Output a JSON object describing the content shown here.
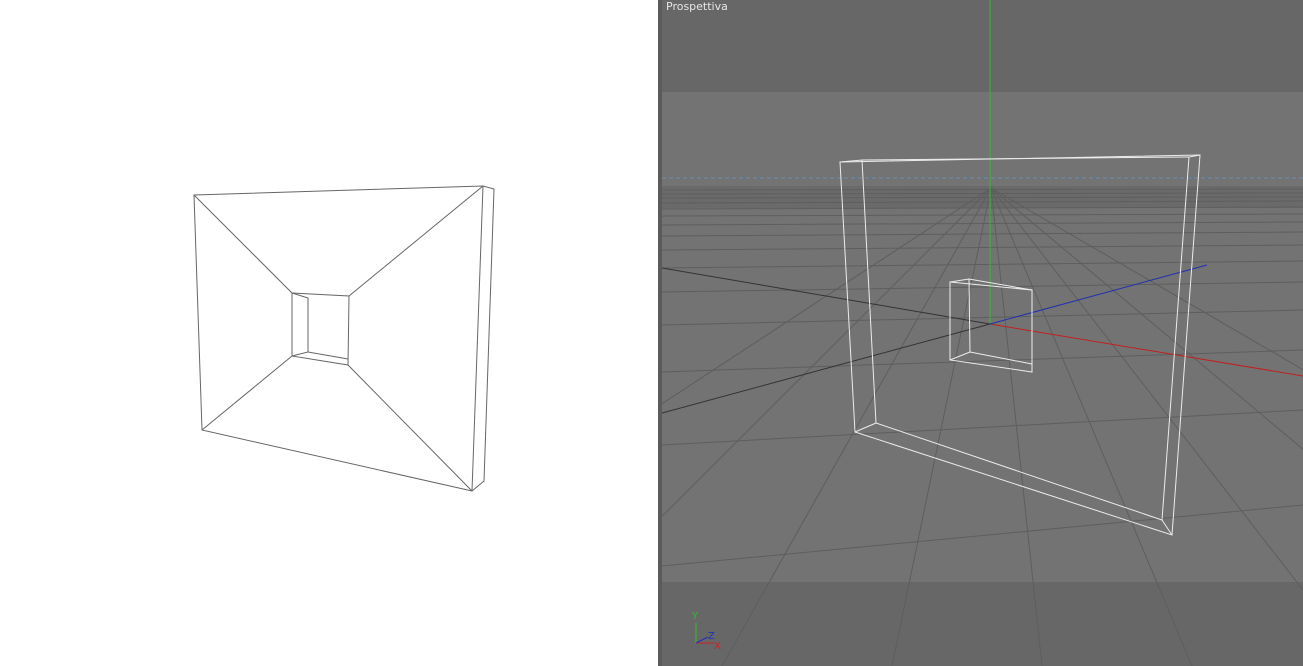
{
  "left_view": {
    "background": "#ffffff",
    "line_color": "#555555"
  },
  "viewport": {
    "label": "Prospettiva",
    "background": "#6b6b6b",
    "band_color": "#737373",
    "wire_color": "#e8e8e8",
    "axes": {
      "y_color": "#2fbf2f",
      "x_color": "#d02020",
      "z_color": "#2030c0"
    },
    "indicator": {
      "y_label": "Y",
      "z_label": "Z",
      "x_label": "X"
    }
  }
}
